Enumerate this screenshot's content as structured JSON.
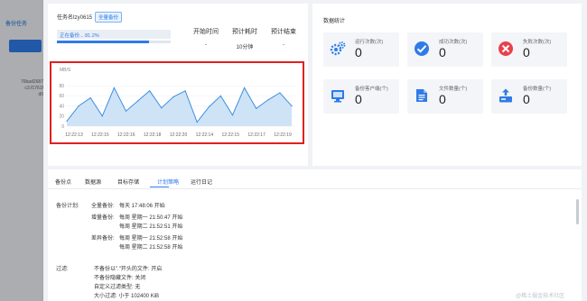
{
  "sidebar": {
    "title": "备份任务",
    "lines": [
      "76bad2687",
      "c3.f1761f",
      "d0"
    ]
  },
  "task": {
    "name": "任务名tzy0615",
    "tag": "全量备份",
    "progress_text": "正在备份... 81.2%",
    "progress": 0.812,
    "meta": [
      {
        "label": "开始时间",
        "value": "-"
      },
      {
        "label": "预计耗时",
        "value": "10分钟"
      },
      {
        "label": "预计结束",
        "value": "-"
      }
    ]
  },
  "chart_data": {
    "type": "area",
    "ylabel": "MB/S",
    "ylim": [
      0,
      100
    ],
    "yticks": [
      0,
      20,
      40,
      60,
      80
    ],
    "xlabels": [
      "12:22:13",
      "12:22:15",
      "12:22:16",
      "12:22:18",
      "12:22:20",
      "12:22:14",
      "12:22:15",
      "12:22:17",
      "12:22:19"
    ],
    "values": [
      10,
      40,
      56,
      20,
      76,
      30,
      50,
      70,
      36,
      58,
      70,
      8,
      38,
      60,
      22,
      76,
      35,
      52,
      66,
      40
    ],
    "color": "#3b8fe0",
    "fill": "#cfe3f7"
  },
  "stats": {
    "title": "数据统计",
    "cards": [
      {
        "icon": "gears-icon",
        "label": "运行次数(次)",
        "value": "0",
        "color": "#2f7be8"
      },
      {
        "icon": "success-icon",
        "label": "成功次数(次)",
        "value": "0",
        "color": "#2f7be8"
      },
      {
        "icon": "failure-icon",
        "label": "失败次数(次)",
        "value": "0",
        "color": "#e8414c"
      },
      {
        "icon": "client-icon",
        "label": "备份客户端(个)",
        "value": "0",
        "color": "#2f7be8"
      },
      {
        "icon": "file-icon",
        "label": "文件数量(个)",
        "value": "0",
        "color": "#2f7be8"
      },
      {
        "icon": "backup-count-icon",
        "label": "备份数量(个)",
        "value": "0",
        "color": "#2f7be8"
      }
    ]
  },
  "detail": {
    "tabs": [
      "备份点",
      "数据源",
      "目标存储",
      "计划策略",
      "运行日记"
    ],
    "active_tab": 3,
    "plan_label": "备份计划:",
    "full_label": "全量备份:",
    "full_value": "每天  17:48:06 开始",
    "incr_label": "增量备份:",
    "incr_rows": [
      "每周  星期一 21:50:47 开始",
      "每周  星期二 21:52:51 开始"
    ],
    "diff_label": "差异备份:",
    "diff_rows": [
      "每周  星期一 21:52:58 开始",
      "每周  星期二 21:52:58 开始"
    ],
    "filter_label": "过滤:",
    "filter_rows": [
      "不备份以\".\"开头的文件: 开启",
      "不备份隐藏文件: 关闭",
      "自定义过滤类型: 无",
      "大小过滤: 小于 102400 KiB"
    ]
  },
  "watermark": "@稀土掘金技术社区"
}
